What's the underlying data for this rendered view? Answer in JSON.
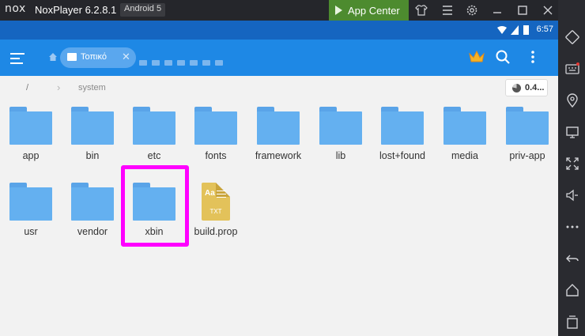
{
  "titlebar": {
    "logo": "nox",
    "title": "NoxPlayer 6.2.8.1",
    "android_badge": "Android 5",
    "app_center_label": "App Center",
    "icons": [
      "shirt-icon",
      "hamburger-menu-icon",
      "gear-icon",
      "minimize-icon",
      "maximize-icon",
      "close-icon",
      "collapse-chevrons-icon"
    ]
  },
  "statusbar": {
    "time": "6:57",
    "icons": [
      "wifi-icon",
      "signal-icon",
      "battery-icon"
    ]
  },
  "appbar": {
    "tab_label": "Τοπικό",
    "tab_close": "✕",
    "icons": [
      "menu-icon",
      "home-icon",
      "crown-icon",
      "search-icon",
      "more-vert-icon"
    ]
  },
  "path": {
    "root": "/",
    "separator": "›",
    "current": "system",
    "storage_label": "0.4..."
  },
  "files": {
    "row1": [
      {
        "name": "app",
        "type": "folder"
      },
      {
        "name": "bin",
        "type": "folder"
      },
      {
        "name": "etc",
        "type": "folder"
      },
      {
        "name": "fonts",
        "type": "folder"
      },
      {
        "name": "framework",
        "type": "folder"
      },
      {
        "name": "lib",
        "type": "folder"
      },
      {
        "name": "lost+found",
        "type": "folder"
      },
      {
        "name": "media",
        "type": "folder"
      },
      {
        "name": "priv-app",
        "type": "folder"
      }
    ],
    "row2": [
      {
        "name": "usr",
        "type": "folder"
      },
      {
        "name": "vendor",
        "type": "folder"
      },
      {
        "name": "xbin",
        "type": "folder",
        "highlighted": true
      },
      {
        "name": "build.prop",
        "type": "txt",
        "icon_text": "Aa",
        "ext": "TXT"
      }
    ]
  },
  "sidebar_icons": [
    "rotate-screen-icon",
    "keyboard-icon",
    "location-icon",
    "screen-icon",
    "fullscreen-icon",
    "volume-icon",
    "more-dots-icon",
    "back-icon",
    "home-icon",
    "recents-icon"
  ],
  "colors": {
    "highlight": "#ff00ff",
    "appbar": "#1e88e5",
    "statusbar": "#1565c0",
    "folder": "#64b0f0",
    "app_center": "#4d8b2f"
  }
}
